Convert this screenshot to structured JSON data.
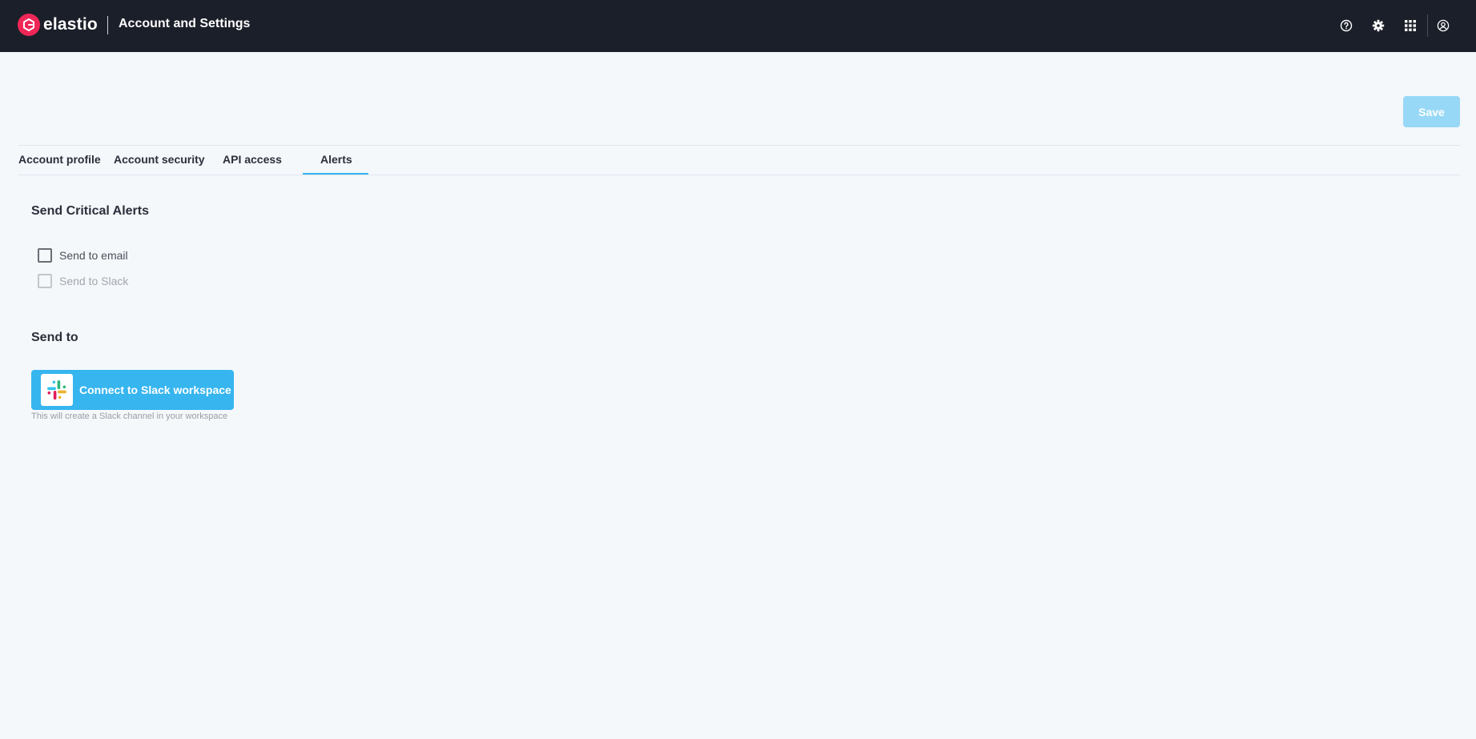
{
  "header": {
    "brand": "elastio",
    "title": "Account and Settings",
    "icons": [
      "help-icon",
      "settings-icon",
      "apps-grid-icon",
      "user-account-icon"
    ]
  },
  "toolbar": {
    "save_label": "Save",
    "save_disabled": true
  },
  "tabs": [
    {
      "label": "Account profile",
      "active": false
    },
    {
      "label": "Account security",
      "active": false
    },
    {
      "label": "API access",
      "active": false
    },
    {
      "label": "Alerts",
      "active": true
    }
  ],
  "alerts": {
    "critical_title": "Send Critical Alerts",
    "options": [
      {
        "label": "Send to email",
        "checked": false,
        "disabled": false
      },
      {
        "label": "Send to Slack",
        "checked": false,
        "disabled": true
      }
    ],
    "send_to_title": "Send to",
    "slack_button_label": "Connect to Slack workspace",
    "slack_hint": "This will create a Slack channel in your workspace"
  },
  "colors": {
    "header_bg": "#1b1f29",
    "brand_accent": "#ef2757",
    "primary": "#36b5ef",
    "primary_disabled": "#97d8f6",
    "page_bg": "#f4f8fb"
  }
}
